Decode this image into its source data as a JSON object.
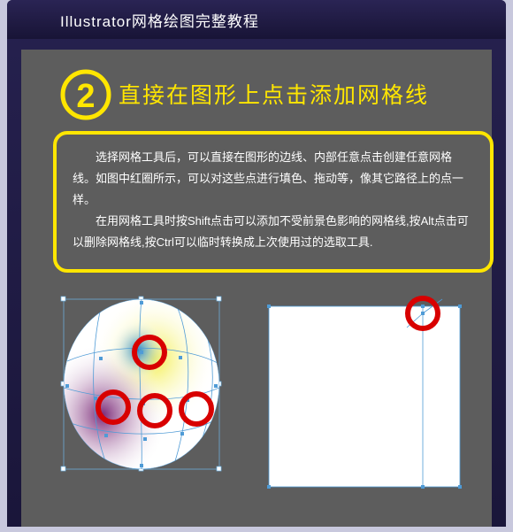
{
  "titlebar": {
    "title": "Illustrator网格绘图完整教程"
  },
  "step": {
    "number": "2",
    "title": "直接在图形上点击添加网格线"
  },
  "box": {
    "p1": "选择网格工具后，可以直接在图形的边线、内部任意点击创建任意网格线。如图中红圈所示，可以对这些点进行填色、拖动等，像其它路径上的点一样。",
    "p2": "在用网格工具时按Shift点击可以添加不受前景色影响的网格线,按Alt点击可以删除网格线,按Ctrl可以临时转换成上次使用过的选取工具."
  }
}
